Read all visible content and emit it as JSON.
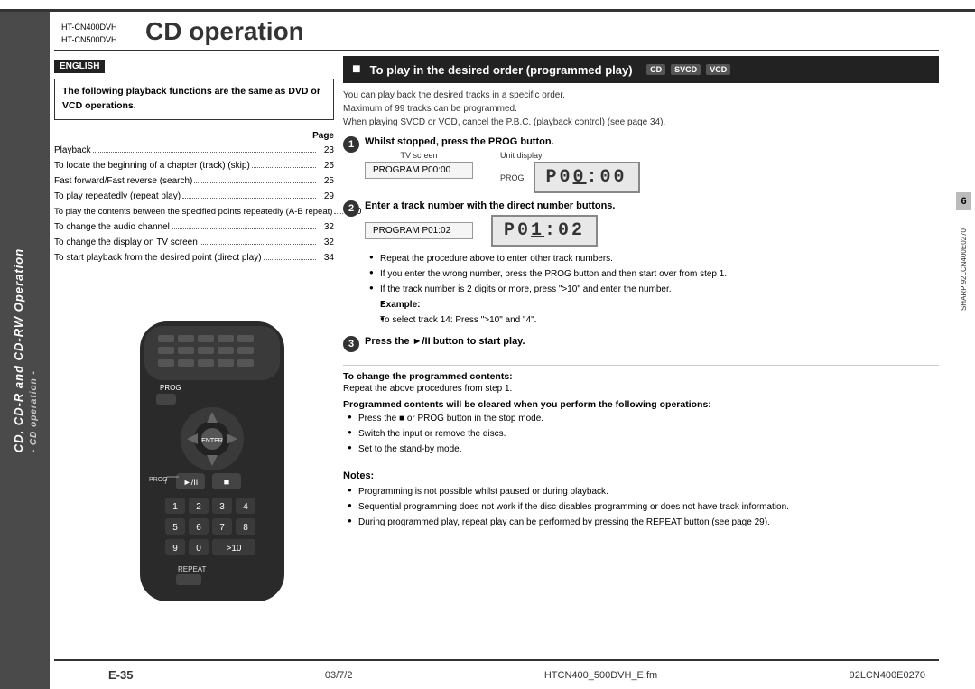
{
  "page": {
    "title": "CD operation",
    "model_numbers": [
      "HT-CN400DVH",
      "HT-CN500DVH"
    ],
    "page_number": "E-35",
    "footer": {
      "date": "03/7/2",
      "filename": "HTCN400_500DVH_E.fm",
      "doc_number": "92LCN400E0270"
    },
    "chapter": "6",
    "right_vert": "SHARP 92LCN400E0270"
  },
  "english_label": "ENGLISH",
  "sidebar_text": "CD, CD-R and CD-RW Operation",
  "sidebar_sub": "- CD operation -",
  "intro": {
    "text": "The following playback functions are the same as DVD or VCD operations."
  },
  "toc": {
    "page_label": "Page",
    "items": [
      {
        "label": "Playback",
        "dots": true,
        "page": "23"
      },
      {
        "label": "To locate the beginning of a chapter (track) (skip)",
        "dots": true,
        "page": "25"
      },
      {
        "label": "Fast forward/Fast reverse (search)",
        "dots": true,
        "page": "25"
      },
      {
        "label": "To play repeatedly (repeat play)",
        "dots": true,
        "page": "29"
      },
      {
        "label": "To play the contents between the specified points repeatedly (A-B repeat)",
        "dots": true,
        "page": "30"
      },
      {
        "label": "To change the audio channel",
        "dots": true,
        "page": "32"
      },
      {
        "label": "To change the display on TV screen",
        "dots": true,
        "page": "32"
      },
      {
        "label": "To start playback from the desired point (direct play)",
        "dots": true,
        "page": "34"
      }
    ]
  },
  "section": {
    "title": "To play in the desired order (programmed play)",
    "disc_badges": [
      "CD",
      "SVCD",
      "VCD"
    ],
    "intro_lines": [
      "You can play back the desired tracks in a specific order.",
      "Maximum of 99 tracks can be programmed.",
      "When playing SVCD or VCD, cancel the P.B.C. (playback control) (see page 34)."
    ],
    "steps": [
      {
        "number": "1",
        "title": "Whilst stopped, press the PROG button.",
        "tv_label": "TV screen",
        "unit_label": "Unit display",
        "prog_label": "PROG",
        "tv_display": "PROGRAM  P00:00",
        "unit_display": "P 0 0 : 0 0"
      },
      {
        "number": "2",
        "title": "Enter a track number with the direct number buttons.",
        "tv_display2": "PROGRAM  P01:02",
        "unit_display2": "P 0 1 : 0 2",
        "bullets": [
          "Repeat the procedure above to enter other track numbers.",
          "If you enter the wrong number, press the PROG button and then start over from step 1.",
          "If the track number is 2 digits or more, press \">10\" and enter the number.",
          "Example:",
          "To select track 14:  Press \">10\" and \"4\"."
        ]
      },
      {
        "number": "3",
        "title": "Press the ►/II button to start play."
      }
    ],
    "change_contents": {
      "title": "To change the programmed contents:",
      "text": "Repeat the above procedures from step 1."
    },
    "programmed_contents": {
      "title": "Programmed contents will be cleared when you perform the following operations:",
      "bullets": [
        "Press the ■ or PROG button in the stop mode.",
        "Switch the input or remove the discs.",
        "Set to the stand-by mode."
      ]
    },
    "notes": {
      "title": "Notes:",
      "bullets": [
        "Programming is not possible whilst paused or during playback.",
        "Sequential programming does not work if the disc disables programming or does not have track information.",
        "During programmed play, repeat play can be performed by pressing the REPEAT button (see page 29)."
      ]
    }
  },
  "remote": {
    "prog_label": "PROG",
    "repeat_label": "REPEAT",
    "play_pause_symbol": "►/II",
    "stop_symbol": "■",
    "numbers": [
      "1",
      "2",
      "3",
      "4",
      "5",
      "6",
      "7",
      "8",
      "9",
      "0",
      ">10"
    ]
  }
}
